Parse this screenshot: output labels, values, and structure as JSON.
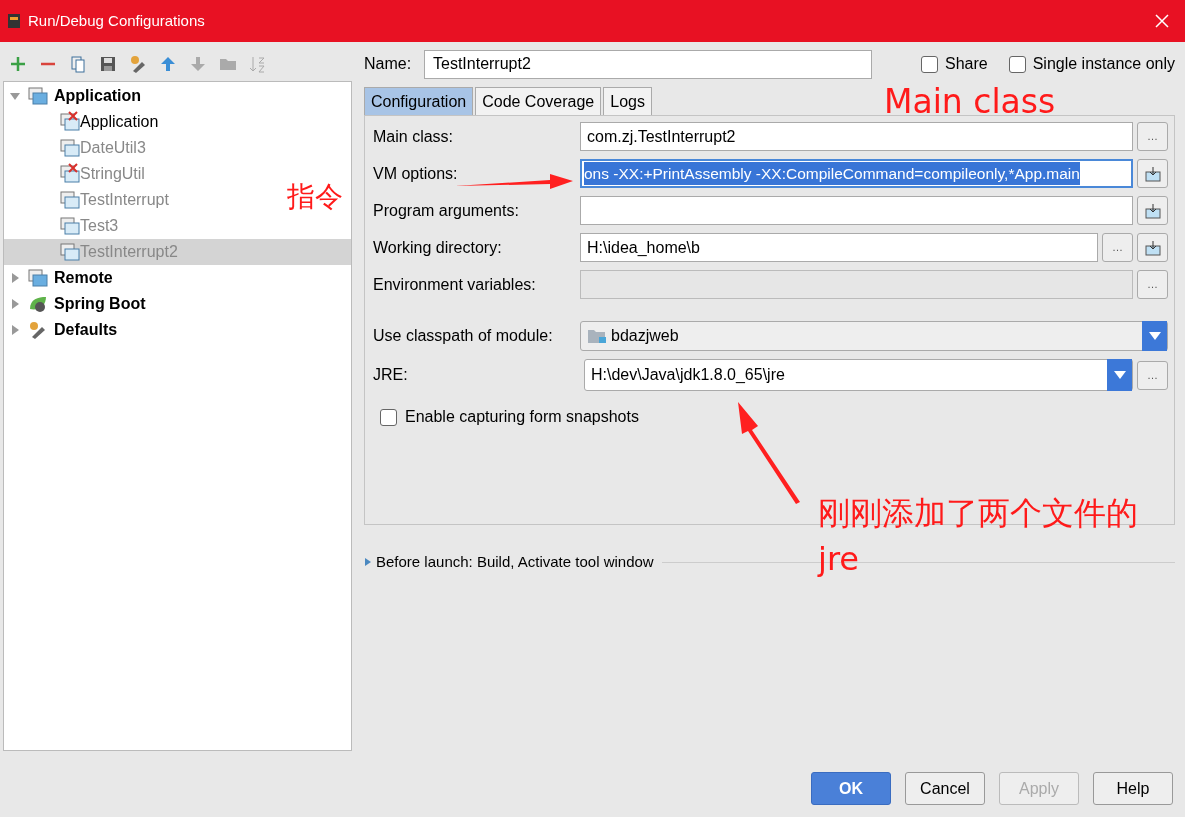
{
  "window": {
    "title": "Run/Debug Configurations"
  },
  "tree": [
    {
      "label": "Application",
      "kind": "application",
      "expanded": true,
      "children": [
        {
          "label": "Application",
          "error": true,
          "temporary": false,
          "selected": false
        },
        {
          "label": "DateUtil3",
          "error": false,
          "temporary": true,
          "selected": false
        },
        {
          "label": "StringUtil",
          "error": true,
          "temporary": true,
          "selected": false
        },
        {
          "label": "TestInterrupt",
          "error": false,
          "temporary": true,
          "selected": false
        },
        {
          "label": "Test3",
          "error": false,
          "temporary": true,
          "selected": false
        },
        {
          "label": "TestInterrupt2",
          "error": false,
          "temporary": true,
          "selected": true
        }
      ]
    },
    {
      "label": "Remote",
      "kind": "remote",
      "expanded": false
    },
    {
      "label": "Spring Boot",
      "kind": "spring",
      "expanded": false
    },
    {
      "label": "Defaults",
      "kind": "defaults",
      "expanded": false
    }
  ],
  "name": {
    "label": "Name:",
    "value": "TestInterrupt2"
  },
  "options": [
    {
      "label": "Share",
      "checked": false
    },
    {
      "label": "Single instance only",
      "checked": false
    }
  ],
  "tabs": [
    {
      "label": "Configuration",
      "selected": true
    },
    {
      "label": "Code Coverage",
      "selected": false
    },
    {
      "label": "Logs",
      "selected": false
    }
  ],
  "fields": [
    {
      "label": "Main class:",
      "kind": "text",
      "value": "com.zj.TestInterrupt2",
      "button": "…"
    },
    {
      "label": "VM options:",
      "kind": "selected-text",
      "value": "ons -XX:+PrintAssembly -XX:CompileCommand=compileonly,*App.main"
    },
    {
      "label": "Program arguments:",
      "kind": "text"
    },
    {
      "label": "Working directory:",
      "kind": "text",
      "value": "H:\\idea_home\\b",
      "button": "…"
    },
    {
      "label": "Environment variables:",
      "kind": "readonly",
      "button": "…"
    }
  ],
  "module": {
    "label": "Use classpath of module:",
    "value": "bdazjweb"
  },
  "jre": {
    "label": "JRE:",
    "value": "H:\\dev\\Java\\jdk1.8.0_65\\jre",
    "button": "…"
  },
  "snapshots": {
    "label": "Enable capturing form snapshots",
    "checked": false
  },
  "before_launch": {
    "label": "Before launch: Build, Activate tool window",
    "expanded": false
  },
  "buttons": [
    {
      "label": "OK",
      "kind": "primary"
    },
    {
      "label": "Cancel",
      "kind": "normal"
    },
    {
      "label": "Apply",
      "kind": "disabled"
    },
    {
      "label": "Help",
      "kind": "normal"
    }
  ],
  "annotations": [
    {
      "text": "Main class"
    },
    {
      "text": "指令"
    },
    {
      "text": "刚刚添加了两个文件的jre"
    }
  ]
}
